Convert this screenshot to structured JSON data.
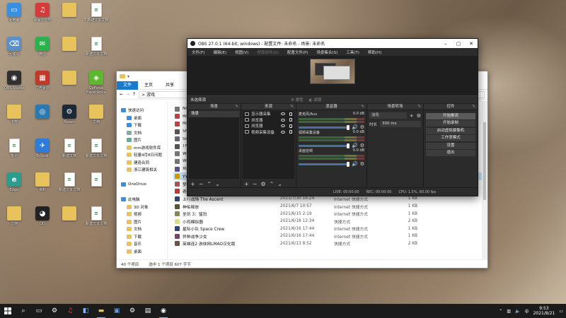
{
  "desktop": {
    "icons": [
      {
        "label": "此电脑",
        "color": "#3b8fe0",
        "glyph": "▭"
      },
      {
        "label": "网易云音乐",
        "color": "#d63b3b",
        "glyph": "♫"
      },
      {
        "label": "",
        "color": "#e8c25a",
        "glyph": ""
      },
      {
        "label": "7.新建文本文档",
        "color": "#2b8a3e",
        "glyph": "≡"
      },
      {
        "label": "回收站",
        "color": "#5a8fc8",
        "glyph": "⌫"
      },
      {
        "label": "微信",
        "color": "#2bb24c",
        "glyph": "✉"
      },
      {
        "label": "",
        "color": "#e8c25a",
        "glyph": ""
      },
      {
        "label": "新建文本文档",
        "color": "#2b8a3e",
        "glyph": "≡"
      },
      {
        "label": "OBS Studio",
        "color": "#303030",
        "glyph": "◉"
      },
      {
        "label": "广告素材",
        "color": "#c0392b",
        "glyph": "▦"
      },
      {
        "label": "",
        "color": "#e8c25a",
        "glyph": ""
      },
      {
        "label": "GeForce Experience",
        "color": "#5cb82e",
        "glyph": "◈"
      },
      {
        "label": "书签",
        "color": "#e8c25a",
        "glyph": ""
      },
      {
        "label": "",
        "color": "#2a7ab0",
        "glyph": "◎"
      },
      {
        "label": "Steam",
        "color": "#1b2838",
        "glyph": "⚙"
      },
      {
        "label": "文档",
        "color": "#e8c25a",
        "glyph": ""
      },
      {
        "label": "笔记",
        "color": "#2b8a3e",
        "glyph": "≡"
      },
      {
        "label": "ToDesk",
        "color": "#2e7bd8",
        "glyph": "✈"
      },
      {
        "label": "新建文档",
        "color": "#2b8a3e",
        "glyph": "≡"
      },
      {
        "label": "新建文本文档",
        "color": "#2b8a3e",
        "glyph": "≡"
      },
      {
        "label": "Edge",
        "color": "#2a9d8f",
        "glyph": "e"
      },
      {
        "label": "资料",
        "color": "#e8c25a",
        "glyph": ""
      },
      {
        "label": "新建文本文档",
        "color": "#2b8a3e",
        "glyph": "≡"
      },
      {
        "label": "",
        "color": "#2b8a3e",
        "glyph": "≡"
      },
      {
        "label": "文档",
        "color": "#e8c25a",
        "glyph": ""
      },
      {
        "label": "QQ",
        "color": "#222",
        "glyph": "◕"
      },
      {
        "label": "",
        "color": "#e8c25a",
        "glyph": ""
      },
      {
        "label": "新建文本文档",
        "color": "#2b8a3e",
        "glyph": "≡"
      }
    ]
  },
  "explorer": {
    "ribbon_tabs": [
      "文件",
      "主页",
      "共享",
      "查看"
    ],
    "path": "> 游戏",
    "nav": [
      {
        "label": "快速访问",
        "type": "star",
        "sub": false
      },
      {
        "label": "桌面",
        "type": "desk",
        "sub": true
      },
      {
        "label": "下载",
        "type": "down",
        "sub": true
      },
      {
        "label": "文档",
        "type": "doc",
        "sub": true
      },
      {
        "label": "图片",
        "type": "pic",
        "sub": true
      },
      {
        "label": "mm游戏软件库",
        "type": "fold",
        "sub": true
      },
      {
        "label": "轻量4月8日问题",
        "type": "fold",
        "sub": true
      },
      {
        "label": "建造合同",
        "type": "fold",
        "sub": true
      },
      {
        "label": "浙江建筑相关",
        "type": "fold",
        "sub": true
      },
      {
        "label": "",
        "type": "none",
        "sub": false
      },
      {
        "label": "OneDrive",
        "type": "cloud",
        "sub": false
      },
      {
        "label": "",
        "type": "none",
        "sub": false
      },
      {
        "label": "此电脑",
        "type": "pc",
        "sub": false
      },
      {
        "label": "3D 对象",
        "type": "fold",
        "sub": true
      },
      {
        "label": "视频",
        "type": "fold",
        "sub": true
      },
      {
        "label": "图片",
        "type": "fold",
        "sub": true
      },
      {
        "label": "文档",
        "type": "fold",
        "sub": true
      },
      {
        "label": "下载",
        "type": "fold",
        "sub": true
      },
      {
        "label": "音乐",
        "type": "fold",
        "sub": true
      },
      {
        "label": "桌面",
        "type": "fold",
        "sub": true
      }
    ],
    "files": [
      {
        "name": "Nie",
        "date": "",
        "type": "",
        "size": "",
        "color": "#777"
      },
      {
        "name": "Ro",
        "date": "",
        "type": "",
        "size": "",
        "color": "#b44"
      },
      {
        "name": "Ro",
        "date": "",
        "type": "",
        "size": "",
        "color": "#b44"
      },
      {
        "name": "She",
        "date": "",
        "type": "",
        "size": "",
        "color": "#555"
      },
      {
        "name": "Sid",
        "date": "",
        "type": "",
        "size": "",
        "color": "#667"
      },
      {
        "name": "Thi",
        "date": "",
        "type": "",
        "size": "",
        "color": "#555"
      },
      {
        "name": "Wa",
        "date": "",
        "type": "",
        "size": "",
        "color": "#777"
      },
      {
        "name": "Wa",
        "date": "",
        "type": "",
        "size": "",
        "color": "#777"
      },
      {
        "name": "XC",
        "date": "",
        "type": "",
        "size": "",
        "color": "#558"
      },
      {
        "name": "YY游戏",
        "date": "",
        "type": "",
        "size": "",
        "color": "#c90"
      },
      {
        "name": "梦幻模拟战2",
        "date": "2021/6/16 15:21",
        "type": "快捷方式",
        "size": "2 KB",
        "color": "#a55"
      },
      {
        "name": "奇游电竞加速器",
        "date": "2021/6/17 20:53",
        "type": "快捷方式",
        "size": "2 KB",
        "color": "#c33"
      },
      {
        "name": "上行战场 The Ascent",
        "date": "2021/7/30 16:24",
        "type": "Internet 快捷方式",
        "size": "1 KB",
        "color": "#346"
      },
      {
        "name": "神佑释放",
        "date": "2021/6/7 10:57",
        "type": "Internet 快捷方式",
        "size": "1 KB",
        "color": "#553"
      },
      {
        "name": "圣剑 3：猛犸",
        "date": "2021/6/15 2:19",
        "type": "Internet 快捷方式",
        "size": "1 KB",
        "color": "#885"
      },
      {
        "name": "小鸡模拟器",
        "date": "2021/6/18 12:34",
        "type": "快捷方式",
        "size": "2 KB",
        "color": "#dd8"
      },
      {
        "name": "星际小队 Space Crew",
        "date": "2021/6/16 17:44",
        "type": "Internet 快捷方式",
        "size": "1 KB",
        "color": "#347"
      },
      {
        "name": "异种战争少女",
        "date": "2021/6/16 17:44",
        "type": "Internet 快捷方式",
        "size": "1 KB",
        "color": "#746"
      },
      {
        "name": "英雄连2 游侠网LMAO汉化版",
        "date": "2021/6/13 8:52",
        "type": "快捷方式",
        "size": "2 KB",
        "color": "#654"
      }
    ],
    "status": [
      "40 个项目",
      "选中 1 个项目 607 字节"
    ]
  },
  "obs": {
    "title": "OBS 27.0.1 (64-bit, windows) - 配置文件: 未命名 - 场景: 未命名",
    "menus": [
      {
        "label": "文件(F)",
        "dim": false
      },
      {
        "label": "编辑(E)",
        "dim": false
      },
      {
        "label": "视图(V)",
        "dim": false
      },
      {
        "label": "停靠部件(D)",
        "dim": true
      },
      {
        "label": "配置文件(P)",
        "dim": false
      },
      {
        "label": "场景集合(S)",
        "dim": false
      },
      {
        "label": "工具(T)",
        "dim": false
      },
      {
        "label": "帮助(H)",
        "dim": false
      }
    ],
    "source_bar": {
      "label": "未选择源",
      "props": "属性",
      "filters": "滤镜"
    },
    "docks": {
      "scenes": {
        "title": "场景",
        "items": [
          "场景"
        ]
      },
      "sources": {
        "title": "来源",
        "items": [
          "显示器采集",
          "浏览器",
          "浏览器",
          "视频采集设备"
        ]
      },
      "mixer": {
        "title": "混音器",
        "channels": [
          {
            "name": "麦克风/Aux",
            "db": "0.0 dB"
          },
          {
            "name": "视频采集设备",
            "db": "0.0 dB"
          },
          {
            "name": "桌面音频",
            "db": "0.0 dB"
          }
        ]
      },
      "transitions": {
        "title": "场景转场",
        "type": "淡化",
        "duration_label": "时长",
        "duration": "300 ms"
      },
      "controls": {
        "title": "控件",
        "buttons": [
          "开始推流",
          "开始录制",
          "启动虚拟摄像机",
          "工作室模式",
          "设置",
          "退出"
        ]
      }
    },
    "status": {
      "live": "LIVE: 00:00:00",
      "rec": "REC: 00:00:00",
      "cpu": "CPU: 1.5%, 60.00 fps"
    }
  },
  "taskbar": {
    "time": "9:53",
    "date": "2021/8/21",
    "ime": "中"
  }
}
